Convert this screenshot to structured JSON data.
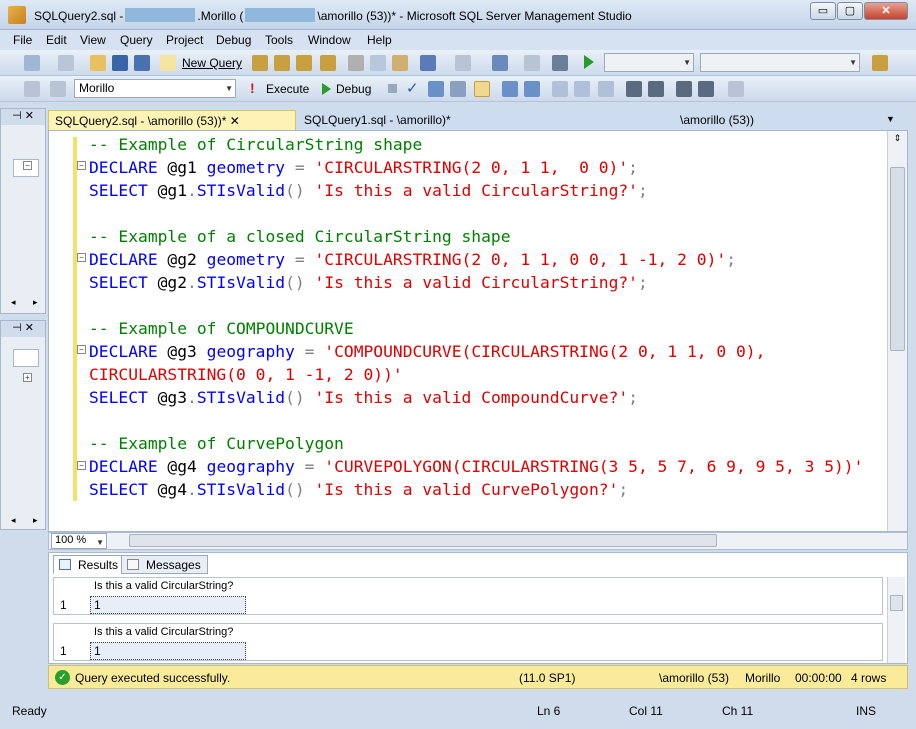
{
  "window": {
    "title_prefix": "SQLQuery2.sql -",
    "title_mid": ".Morillo (",
    "title_suffix": "\\amorillo (53))* - Microsoft SQL Server Management Studio",
    "minimize": "▭",
    "maximize": "▢",
    "close": "✕"
  },
  "menu": [
    "File",
    "Edit",
    "View",
    "Query",
    "Project",
    "Debug",
    "Tools",
    "Window",
    "Help"
  ],
  "toolbar1": {
    "new_query": "New Query"
  },
  "toolbar2": {
    "database": "Morillo",
    "execute": "Execute",
    "debug": "Debug"
  },
  "object_explorer": {
    "pin": "⊣ ✕"
  },
  "tabs": [
    {
      "label": "SQLQuery2.sql -            \\amorillo (53))*",
      "close": "✕"
    },
    {
      "label": "SQLQuery1.sql -                           \\amorillo)*"
    },
    {
      "label": "\\amorillo (53))"
    }
  ],
  "code_lines": [
    [
      {
        "c": "cm",
        "t": "-- Example of CircularString shape"
      }
    ],
    [
      {
        "c": "kw",
        "t": "DECLARE "
      },
      {
        "c": "id",
        "t": "@g1 "
      },
      {
        "c": "kw",
        "t": "geometry "
      },
      {
        "c": "gy",
        "t": "= "
      },
      {
        "c": "st",
        "t": "'CIRCULARSTRING(2 0, 1 1,  0 0)'"
      },
      {
        "c": "gy",
        "t": ";"
      }
    ],
    [
      {
        "c": "kw",
        "t": "SELECT "
      },
      {
        "c": "id",
        "t": "@g1"
      },
      {
        "c": "gy",
        "t": "."
      },
      {
        "c": "kw",
        "t": "STIsValid"
      },
      {
        "c": "gy",
        "t": "() "
      },
      {
        "c": "st",
        "t": "'Is this a valid CircularString?'"
      },
      {
        "c": "gy",
        "t": ";"
      }
    ],
    [],
    [
      {
        "c": "cm",
        "t": "-- Example of a closed CircularString shape"
      }
    ],
    [
      {
        "c": "kw",
        "t": "DECLARE "
      },
      {
        "c": "id",
        "t": "@g2 "
      },
      {
        "c": "kw",
        "t": "geometry "
      },
      {
        "c": "gy",
        "t": "= "
      },
      {
        "c": "st",
        "t": "'CIRCULARSTRING(2 0, 1 1, 0 0, 1 -1, 2 0)'"
      },
      {
        "c": "gy",
        "t": ";"
      }
    ],
    [
      {
        "c": "kw",
        "t": "SELECT "
      },
      {
        "c": "id",
        "t": "@g2"
      },
      {
        "c": "gy",
        "t": "."
      },
      {
        "c": "kw",
        "t": "STIsValid"
      },
      {
        "c": "gy",
        "t": "() "
      },
      {
        "c": "st",
        "t": "'Is this a valid CircularString?'"
      },
      {
        "c": "gy",
        "t": ";"
      }
    ],
    [],
    [
      {
        "c": "cm",
        "t": "-- Example of COMPOUNDCURVE"
      }
    ],
    [
      {
        "c": "kw",
        "t": "DECLARE "
      },
      {
        "c": "id",
        "t": "@g3 "
      },
      {
        "c": "kw",
        "t": "geography "
      },
      {
        "c": "gy",
        "t": "= "
      },
      {
        "c": "st",
        "t": "'COMPOUNDCURVE(CIRCULARSTRING(2 0, 1 1, 0 0),"
      }
    ],
    [
      {
        "c": "st",
        "t": "CIRCULARSTRING(0 0, 1 -1, 2 0))'"
      }
    ],
    [
      {
        "c": "kw",
        "t": "SELECT "
      },
      {
        "c": "id",
        "t": "@g3"
      },
      {
        "c": "gy",
        "t": "."
      },
      {
        "c": "kw",
        "t": "STIsValid"
      },
      {
        "c": "gy",
        "t": "() "
      },
      {
        "c": "st",
        "t": "'Is this a valid CompoundCurve?'"
      },
      {
        "c": "gy",
        "t": ";"
      }
    ],
    [],
    [
      {
        "c": "cm",
        "t": "-- Example of CurvePolygon"
      }
    ],
    [
      {
        "c": "kw",
        "t": "DECLARE "
      },
      {
        "c": "id",
        "t": "@g4 "
      },
      {
        "c": "kw",
        "t": "geography "
      },
      {
        "c": "gy",
        "t": "= "
      },
      {
        "c": "st",
        "t": "'CURVEPOLYGON(CIRCULARSTRING(3 5, 5 7, 6 9, 9 5, 3 5))'"
      }
    ],
    [
      {
        "c": "kw",
        "t": "SELECT "
      },
      {
        "c": "id",
        "t": "@g4"
      },
      {
        "c": "gy",
        "t": "."
      },
      {
        "c": "kw",
        "t": "STIsValid"
      },
      {
        "c": "gy",
        "t": "() "
      },
      {
        "c": "st",
        "t": "'Is this a valid CurvePolygon?'"
      },
      {
        "c": "gy",
        "t": ";"
      }
    ]
  ],
  "zoom": "100 %",
  "results_tabs": {
    "results": "Results",
    "messages": "Messages"
  },
  "grids": [
    {
      "header": "Is this a valid CircularString?",
      "row": "1",
      "value": "1"
    },
    {
      "header": "Is this a valid CircularString?",
      "row": "1",
      "value": "1"
    }
  ],
  "status": {
    "message": "Query executed successfully.",
    "version": "(11.0 SP1)",
    "user": "\\amorillo (53)",
    "db": "Morillo",
    "time": "00:00:00",
    "rows": "4 rows"
  },
  "bottom": {
    "ready": "Ready",
    "ln": "Ln 6",
    "col": "Col 11",
    "ch": "Ch 11",
    "ins": "INS"
  }
}
